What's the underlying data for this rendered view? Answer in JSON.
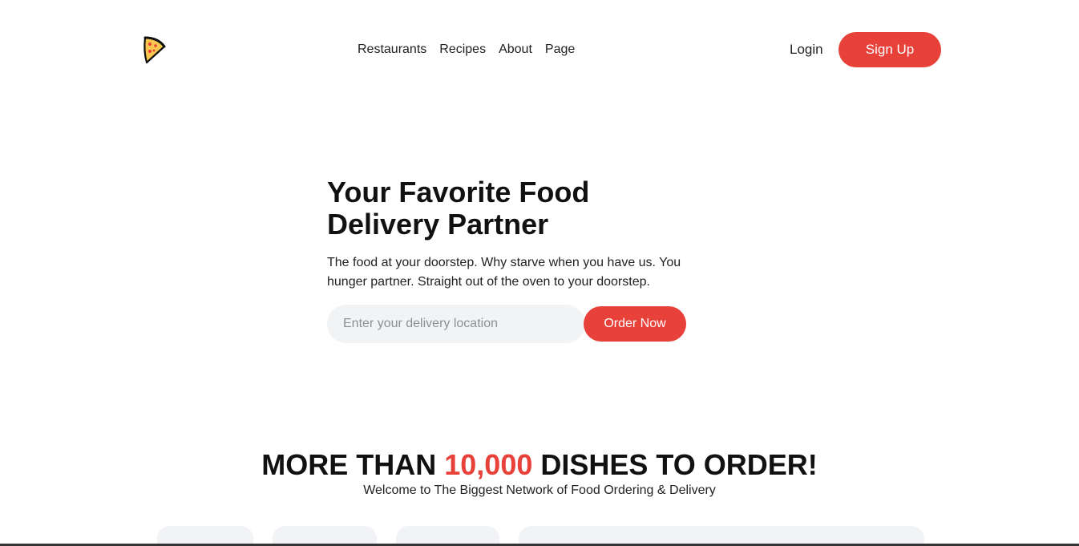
{
  "header": {
    "logo_icon": "pizza-slice-icon",
    "nav": [
      "Restaurants",
      "Recipes",
      "About",
      "Page"
    ],
    "login_label": "Login",
    "signup_label": "Sign Up"
  },
  "hero": {
    "title_line1": "Your Favorite Food",
    "title_line2": "Delivery Partner",
    "description_line1": "The food at your doorstep. Why starve when you have us. You",
    "description_line2": "hunger partner. Straight out of the oven to your doorstep.",
    "location_placeholder": "Enter your delivery location",
    "location_value": "",
    "order_label": "Order Now"
  },
  "dishes": {
    "title_before": "MORE THAN ",
    "title_accent": "10,000",
    "title_after": " DISHES TO ORDER!",
    "subtitle": "Welcome to The Biggest Network of Food Ordering & Delivery"
  },
  "colors": {
    "accent": "#e8413a",
    "input_bg": "#f2f3f5",
    "card_bg": "#f1f3f6"
  }
}
